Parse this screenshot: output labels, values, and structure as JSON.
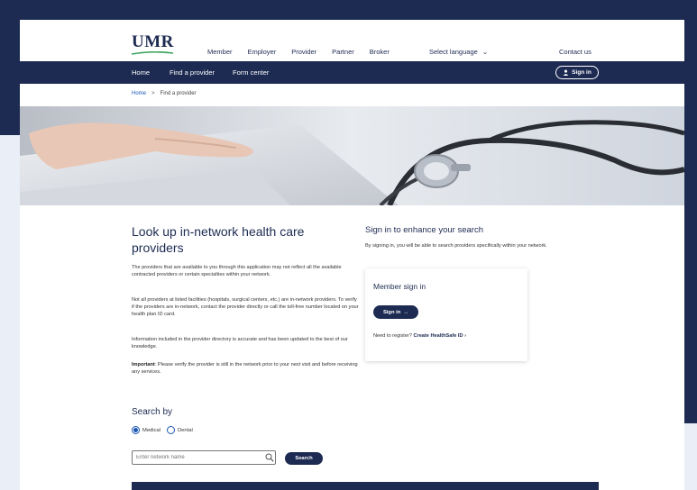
{
  "brand": {
    "logo_text": "UMR"
  },
  "top_nav": {
    "items": [
      "Member",
      "Employer",
      "Provider",
      "Partner",
      "Broker"
    ],
    "language_label": "Select language",
    "contact_label": "Contact us"
  },
  "main_nav": {
    "items": [
      "Home",
      "Find a provider",
      "Form center"
    ],
    "signin_label": "Sign in"
  },
  "breadcrumb": {
    "home": "Home",
    "separator": ">",
    "current": "Find a provider"
  },
  "intro": {
    "title": "Look up in-network health care providers",
    "para1": "The providers that are available to you through this application may not reflect all the available contracted providers or certain specialties within your network.",
    "para2": "Not all providers at listed facilities (hospitals, surgical centers, etc.) are in-network providers. To verify if the providers are in-network, contact the provider directly or call the toll-free number located on your health plan ID card.",
    "para3": "Information included in the provider directory is accurate and has been updated to the best of our knowledge.",
    "important_label": "Important",
    "para4": ": Please verify the provider is still in the network prior to your next visit and before receiving any services."
  },
  "enhance": {
    "title": "Sign in to enhance your search",
    "text": "By signing in, you will be able to search providers specifically within your network."
  },
  "member_card": {
    "title": "Member sign in",
    "button_label": "Sign in",
    "register_text": "Need to register?",
    "register_link": "Create HealthSafe ID"
  },
  "search": {
    "title": "Search by",
    "option_medical": "Medical",
    "option_dental": "Dental",
    "selected": "Medical",
    "placeholder": "Enter network name",
    "button_label": "Search"
  },
  "colors": {
    "navy": "#1d2b52",
    "link_blue": "#1a56b6",
    "logo_green": "#3aa35b"
  }
}
